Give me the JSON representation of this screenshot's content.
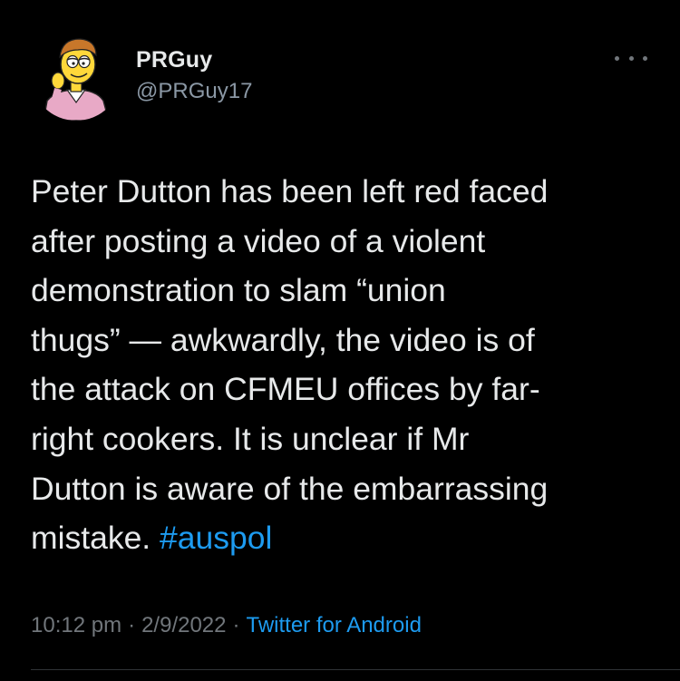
{
  "author": {
    "name": "PRGuy",
    "handle": "@PRGuy17",
    "avatar_icon": "cartoon-character-avatar"
  },
  "tweet": {
    "lines": [
      "Peter Dutton has been left red faced",
      "after posting a video of a violent",
      "demonstration to slam “union",
      "thugs” — awkwardly, the video is of",
      "the attack on CFMEU offices by far-",
      "right cookers. It is unclear if Mr",
      "Dutton is aware of the embarrassing"
    ],
    "last_line_text": "mistake.",
    "hashtag": "#auspol"
  },
  "meta": {
    "time": "10:12 pm",
    "date": "2/9/2022",
    "separator": "·",
    "source": "Twitter for Android"
  },
  "more_icon": "more-options-icon",
  "colors": {
    "background": "#000000",
    "text": "#e7e9ea",
    "secondary": "#71767b",
    "link": "#1d9bf0"
  }
}
